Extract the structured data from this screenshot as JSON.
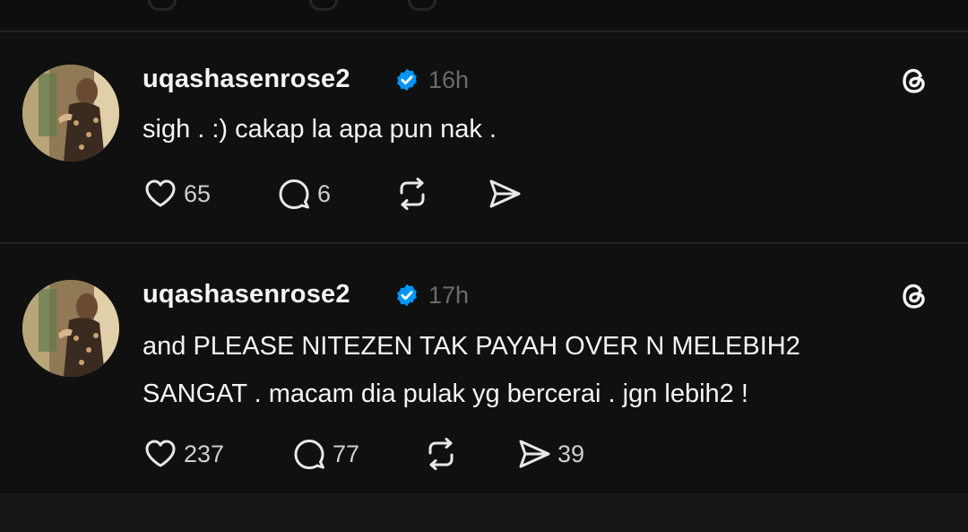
{
  "posts": [
    {
      "username": "uqashasenrose2",
      "time": "16h",
      "text_lines": [
        "sigh . :) cakap la apa pun nak ."
      ],
      "likes": "65",
      "replies": "6",
      "reposts": "",
      "shares": ""
    },
    {
      "username": "uqashasenrose2",
      "time": "17h",
      "text_lines": [
        "and PLEASE NITEZEN TAK PAYAH OVER N MELEBIH2",
        "SANGAT . macam dia pulak yg bercerai . jgn lebih2 !"
      ],
      "likes": "237",
      "replies": "77",
      "reposts": "",
      "shares": "39"
    }
  ],
  "colors": {
    "background": "#101010",
    "text": "#f3f5f7",
    "muted": "#6b6b6b",
    "verified": "#0095f6",
    "divider": "#222222"
  },
  "icons": {
    "verified": "verified-badge-icon",
    "threads": "threads-logo-icon",
    "like": "heart-icon",
    "reply": "comment-icon",
    "repost": "repost-icon",
    "share": "send-icon"
  }
}
